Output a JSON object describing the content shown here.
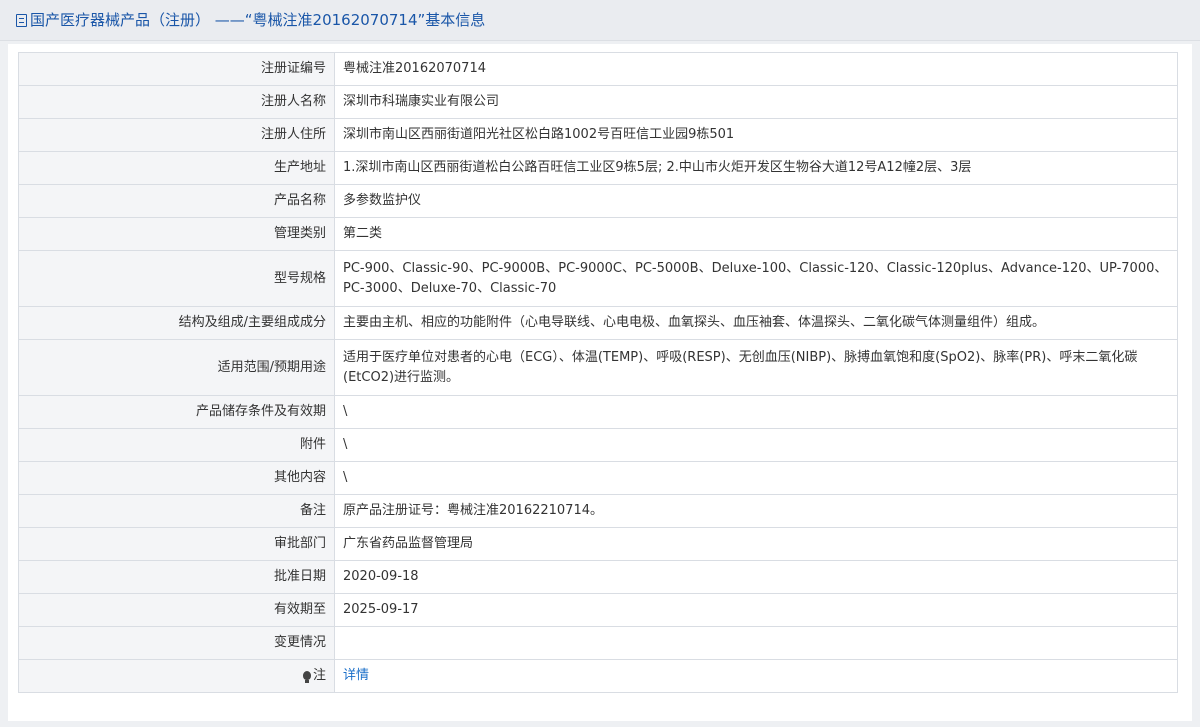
{
  "header": {
    "title": "国产医疗器械产品（注册）  ——“粤械注准20162070714”基本信息"
  },
  "rows": [
    {
      "label": "注册证编号",
      "value": "粤械注准20162070714"
    },
    {
      "label": "注册人名称",
      "value": "深圳市科瑞康实业有限公司"
    },
    {
      "label": "注册人住所",
      "value": "深圳市南山区西丽街道阳光社区松白路1002号百旺信工业园9栋501"
    },
    {
      "label": "生产地址",
      "value": "1.深圳市南山区西丽街道松白公路百旺信工业区9栋5层; 2.中山市火炬开发区生物谷大道12号A12幢2层、3层"
    },
    {
      "label": "产品名称",
      "value": "多参数监护仪"
    },
    {
      "label": "管理类别",
      "value": "第二类"
    },
    {
      "label": "型号规格",
      "value": "PC-900、Classic-90、PC-9000B、PC-9000C、PC-5000B、Deluxe-100、Classic-120、Classic-120plus、Advance-120、UP-7000、 PC-3000、Deluxe-70、Classic-70"
    },
    {
      "label": "结构及组成/主要组成成分",
      "value": "主要由主机、相应的功能附件（心电导联线、心电电极、血氧探头、血压袖套、体温探头、二氧化碳气体测量组件）组成。"
    },
    {
      "label": "适用范围/预期用途",
      "value": "适用于医疗单位对患者的心电（ECG）、体温(TEMP)、呼吸(RESP)、无创血压(NIBP)、脉搏血氧饱和度(SpO2)、脉率(PR)、呼末二氧化碳(EtCO2)进行监测。"
    },
    {
      "label": "产品储存条件及有效期",
      "value": "\\"
    },
    {
      "label": "附件",
      "value": "\\"
    },
    {
      "label": "其他内容",
      "value": "\\"
    },
    {
      "label": "备注",
      "value": "原产品注册证号：粤械注准20162210714。"
    },
    {
      "label": "审批部门",
      "value": "广东省药品监督管理局"
    },
    {
      "label": "批准日期",
      "value": "2020-09-18"
    },
    {
      "label": "有效期至",
      "value": "2025-09-17"
    },
    {
      "label": "变更情况",
      "value": ""
    }
  ],
  "note": {
    "label": "注",
    "link": "详情"
  }
}
